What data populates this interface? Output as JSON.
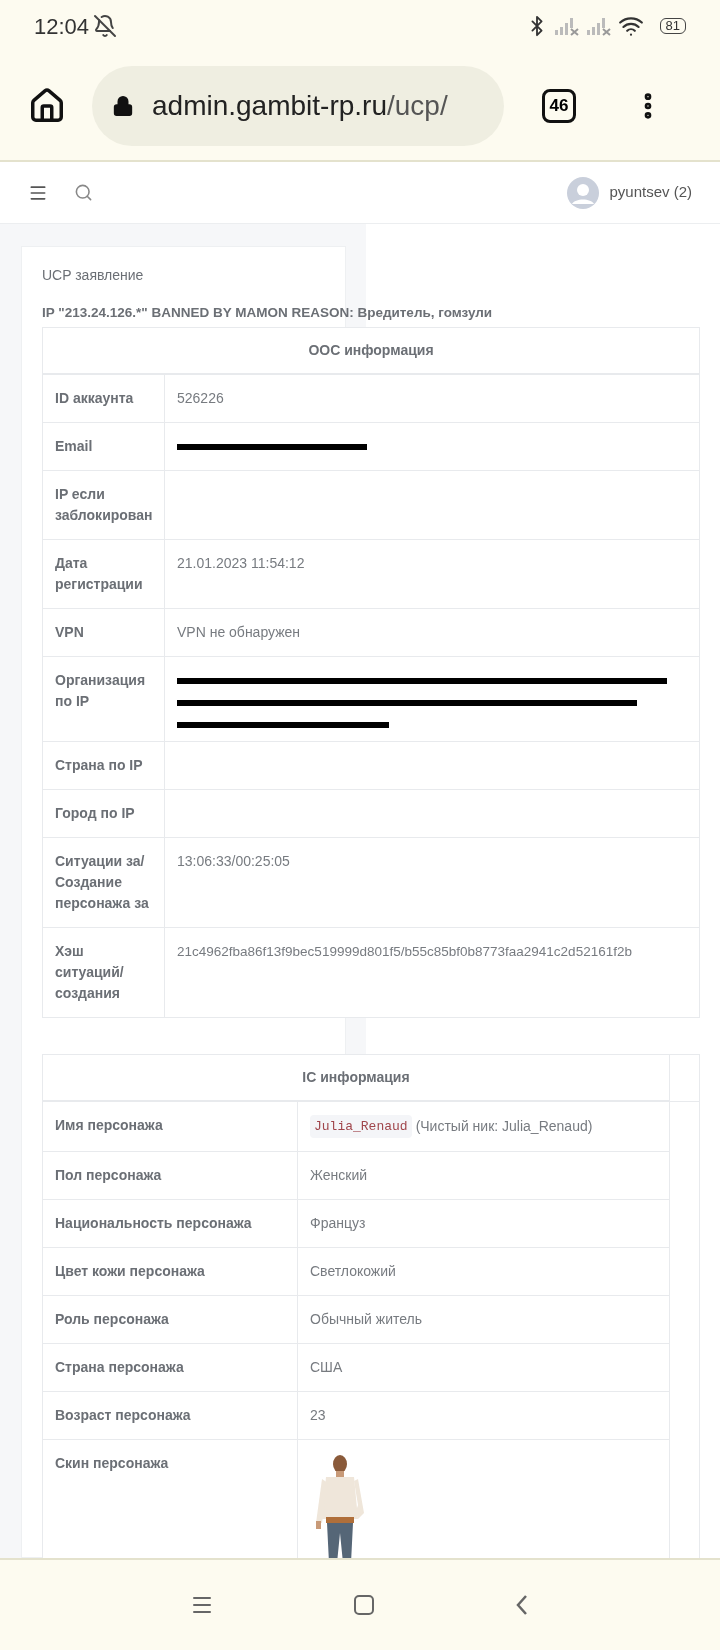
{
  "status_bar": {
    "time": "12:04",
    "battery": "81"
  },
  "browser": {
    "url_host": "admin.gambit-rp.ru",
    "url_path": "/ucp/",
    "tab_count": "46"
  },
  "nav": {
    "user": "pyuntsev (2)"
  },
  "card": {
    "title": "UCP заявление",
    "ban_notice": "IP \"213.24.126.*\" BANNED BY MAMON REASON: Вредитель, гомзули"
  },
  "ooc_table": {
    "heading": "OOC информация",
    "rows": [
      {
        "label": "ID аккаунта",
        "kind": "text",
        "value": "526226"
      },
      {
        "label": "Email",
        "kind": "redacted",
        "redactions": [
          {
            "kind": "medium"
          }
        ]
      },
      {
        "label": "IP если заблокирован",
        "kind": "empty"
      },
      {
        "label": "Дата регистрации",
        "kind": "text",
        "value": "21.01.2023 11:54:12"
      },
      {
        "label": "VPN",
        "kind": "text",
        "value": "VPN не обнаружен"
      },
      {
        "label": "Организация по IP",
        "kind": "redacted",
        "redactions": [
          {
            "kind": "full"
          },
          {
            "kind": "wide"
          },
          {
            "kind": "short"
          }
        ]
      },
      {
        "label": "Страна по IP",
        "kind": "empty"
      },
      {
        "label": "Город по IP",
        "kind": "empty"
      },
      {
        "label": "Ситуации за/ Создание персонажа за",
        "kind": "text",
        "value": "13:06:33/00:25:05"
      },
      {
        "label": "Хэш ситуаций/ создания",
        "kind": "hash",
        "value": "21c4962fba86f13f9bec519999d801f5/b55c85bf0b8773faa2941c2d52161f2b"
      }
    ]
  },
  "ic_table": {
    "heading": "IC информация",
    "rows": [
      {
        "label": "Имя персонажа",
        "kind": "name",
        "code": "Julia_Renaud",
        "value": "(Чистый ник: Julia_Renaud)"
      },
      {
        "label": "Пол персонажа",
        "kind": "text",
        "value": "Женский"
      },
      {
        "label": "Национальность персонажа",
        "kind": "text",
        "value": "Француз"
      },
      {
        "label": "Цвет кожи персонажа",
        "kind": "text",
        "value": "Светлокожий"
      },
      {
        "label": "Роль персонажа",
        "kind": "text",
        "value": "Обычный житель"
      },
      {
        "label": "Страна персонажа",
        "kind": "text",
        "value": "США"
      },
      {
        "label": "Возраст персонажа",
        "kind": "text",
        "value": "23"
      },
      {
        "label": "Скин персонажа",
        "kind": "picture"
      }
    ]
  }
}
